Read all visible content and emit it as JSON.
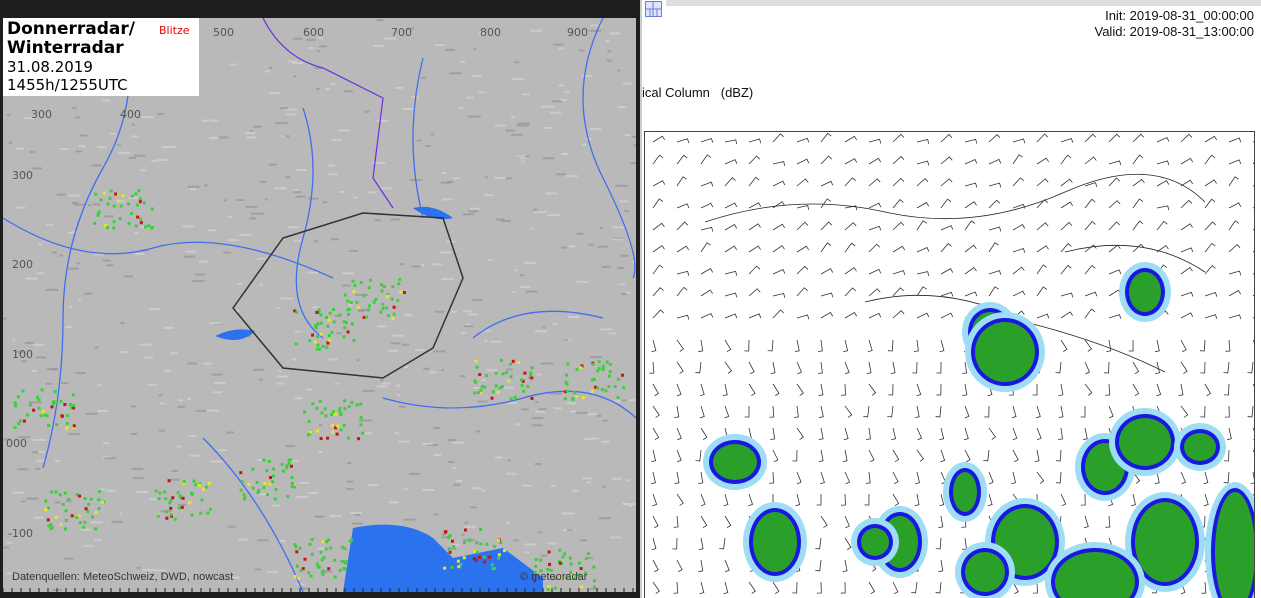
{
  "radar": {
    "title_line1": "Donnerradar/",
    "title_line2": "Winterradar",
    "date": "31.08.2019",
    "time": "1455h/1255UTC",
    "layer_label": "Blitze",
    "x_ticks": [
      "500",
      "600",
      "700",
      "800",
      "900"
    ],
    "x_ticks_inner": [
      "300",
      "400"
    ],
    "y_ticks": [
      "300",
      "200",
      "100",
      "000",
      "-100"
    ],
    "sources": "Datenquellen: MeteoSchweiz, DWD, nowcast",
    "copyright": "© meteoradar"
  },
  "model": {
    "init": "Init: 2019-08-31_00:00:00",
    "valid": "Valid: 2019-08-31_13:00:00",
    "variable": "ical Column   (dBZ)"
  },
  "colors": {
    "lake": "#2a72ee",
    "river": "#3f6ff0",
    "border": "#6a2ee0",
    "green": "#3ccf3c",
    "yellow": "#e6e62a",
    "red": "#cc1111",
    "dbz_light": "#9fdcf5",
    "dbz_mid": "#4a8ef0",
    "dbz_blue": "#1818e0",
    "dbz_green": "#2aa02a"
  }
}
